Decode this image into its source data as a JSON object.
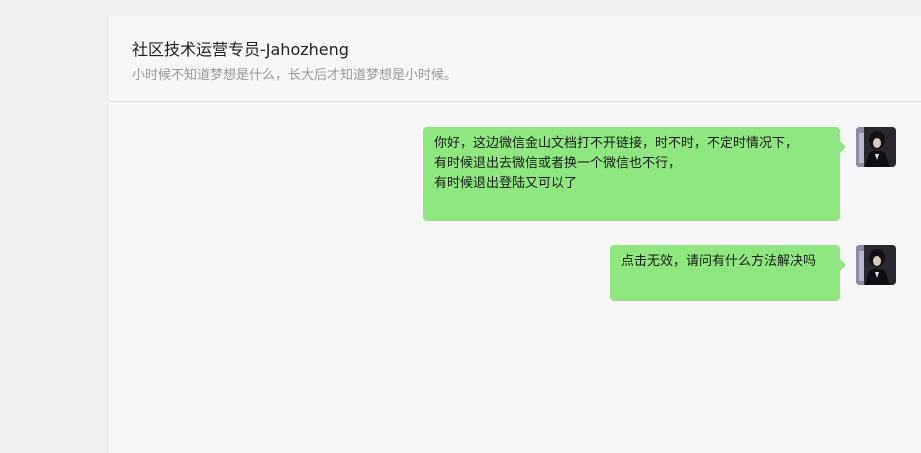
{
  "chat": {
    "title": "社区技术运营专员-Jahozheng",
    "subtitle": "小时候不知道梦想是什么，长大后才知道梦想是小时候。"
  },
  "messages": [
    {
      "sender": "self",
      "avatar_icon": "user-avatar-icon",
      "lines": [
        "你好，这边微信金山文档打不开链接，时不时，不定时情况下，",
        "有时候退出去微信或者换一个微信也不行，",
        "有时候退出登陆又可以了"
      ]
    },
    {
      "sender": "self",
      "avatar_icon": "user-avatar-icon",
      "lines": [
        "点击无效，请问有什么方法解决吗"
      ]
    }
  ],
  "colors": {
    "bubble": "#8fe77f",
    "panel_bg": "#f7f7f7",
    "page_bg": "#efefef"
  }
}
